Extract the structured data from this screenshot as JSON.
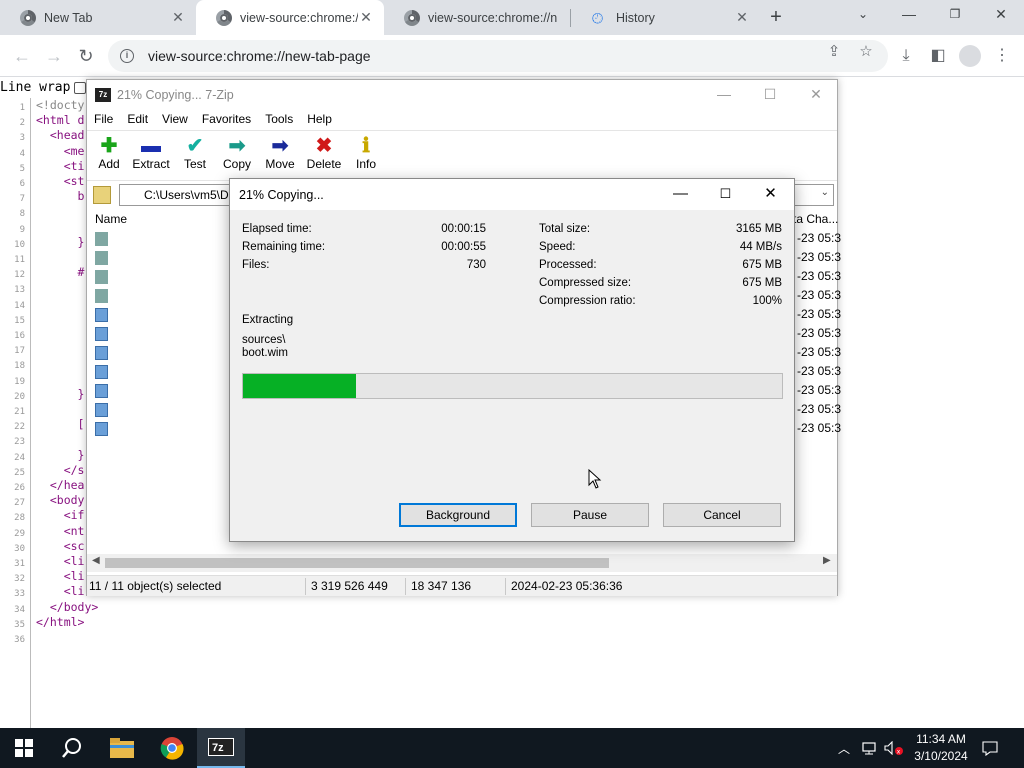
{
  "browser": {
    "tabs": [
      {
        "label": "New Tab",
        "active": false
      },
      {
        "label": "view-source:chrome://n",
        "active": true
      },
      {
        "label": "view-source:chrome://n",
        "active": false
      },
      {
        "label": "History",
        "active": false
      }
    ],
    "url": "view-source:chrome://new-tab-page"
  },
  "viewsource": {
    "line_wrap_label": "Line wrap",
    "line_numbers": [
      "1",
      "2",
      "3",
      "4",
      "5",
      "6",
      "7",
      "8",
      "9",
      "10",
      "11",
      "12",
      "13",
      "14",
      "15",
      "16",
      "17",
      "18",
      "19",
      "20",
      "21",
      "22",
      "23",
      "24",
      "25",
      "26",
      "27",
      "28",
      "29",
      "30",
      "31",
      "32",
      "33",
      "34",
      "35",
      "36"
    ],
    "lines": [
      {
        "text": "<!docty",
        "comment": true
      },
      {
        "text": "<html d"
      },
      {
        "text": "  <head"
      },
      {
        "text": "    <me"
      },
      {
        "text": "    <ti"
      },
      {
        "text": "    <st"
      },
      {
        "text": "      b"
      },
      {
        "text": ""
      },
      {
        "text": ""
      },
      {
        "text": "      }"
      },
      {
        "text": ""
      },
      {
        "text": "      #"
      },
      {
        "text": ""
      },
      {
        "text": ""
      },
      {
        "text": ""
      },
      {
        "text": ""
      },
      {
        "text": ""
      },
      {
        "text": ""
      },
      {
        "text": ""
      },
      {
        "text": "      }"
      },
      {
        "text": ""
      },
      {
        "text": "      ["
      },
      {
        "text": ""
      },
      {
        "text": "      }"
      },
      {
        "text": "    </s"
      },
      {
        "text": "  </hea"
      },
      {
        "text": "  <body"
      },
      {
        "text": "    <if"
      },
      {
        "text": "    <nt"
      },
      {
        "text": "    <sc"
      },
      {
        "text": "    <li"
      },
      {
        "text": "    <li"
      },
      {
        "text": "    <li"
      },
      {
        "text": "  </body>"
      },
      {
        "text": "</html>"
      },
      {
        "text": ""
      }
    ]
  },
  "zip": {
    "title": "21% Copying... 7-Zip",
    "app_icon": "7z",
    "menu": [
      "File",
      "Edit",
      "View",
      "Favorites",
      "Tools",
      "Help"
    ],
    "toolbar": [
      {
        "label": "Add",
        "icon": "plus-icon",
        "color": "#1aa51a"
      },
      {
        "label": "Extract",
        "icon": "minus-icon",
        "color": "#1a2fb0"
      },
      {
        "label": "Test",
        "icon": "check-icon",
        "color": "#14b0a0"
      },
      {
        "label": "Copy",
        "icon": "copy-arrow-icon",
        "color": "#1a9a8a"
      },
      {
        "label": "Move",
        "icon": "move-arrow-icon",
        "color": "#1a2a9a"
      },
      {
        "label": "Delete",
        "icon": "delete-x-icon",
        "color": "#d01818"
      },
      {
        "label": "Info",
        "icon": "info-icon",
        "color": "#c8a800"
      }
    ],
    "address": "C:\\Users\\vm5\\D",
    "column_name": "Name",
    "column_dates": "ta Cha...",
    "dates": [
      "-23 05:3",
      "-23 05:3",
      "-23 05:3",
      "-23 05:3",
      "-23 05:3",
      "-23 05:3",
      "-23 05:3",
      "-23 05:3",
      "-23 05:3",
      "-23 05:3",
      "-23 05:3"
    ],
    "status": {
      "selected": "11 / 11 object(s) selected",
      "size": "3 319 526 449",
      "packed": "18 347 136",
      "modified": "2024-02-23 05:36:36"
    }
  },
  "dialog": {
    "title": "21% Copying...",
    "left_stats": [
      {
        "label": "Elapsed time:",
        "value": "00:00:15"
      },
      {
        "label": "Remaining time:",
        "value": "00:00:55"
      },
      {
        "label": "Files:",
        "value": "730"
      }
    ],
    "right_stats": [
      {
        "label": "Total size:",
        "value": "3165 MB"
      },
      {
        "label": "Speed:",
        "value": "44 MB/s"
      },
      {
        "label": "Processed:",
        "value": "675 MB"
      },
      {
        "label": "Compressed size:",
        "value": "675 MB"
      },
      {
        "label": "Compression ratio:",
        "value": "100%"
      }
    ],
    "operation": "Extracting",
    "path_line1": "sources\\",
    "path_line2": "boot.wim",
    "progress_percent": 21,
    "progress_color": "#06b025",
    "buttons": {
      "background": "Background",
      "pause": "Pause",
      "cancel": "Cancel"
    }
  },
  "taskbar": {
    "time": "11:34 AM",
    "date": "3/10/2024",
    "apps": [
      "start-icon",
      "search-icon",
      "file-explorer-icon",
      "chrome-icon",
      "7zip-icon"
    ]
  }
}
